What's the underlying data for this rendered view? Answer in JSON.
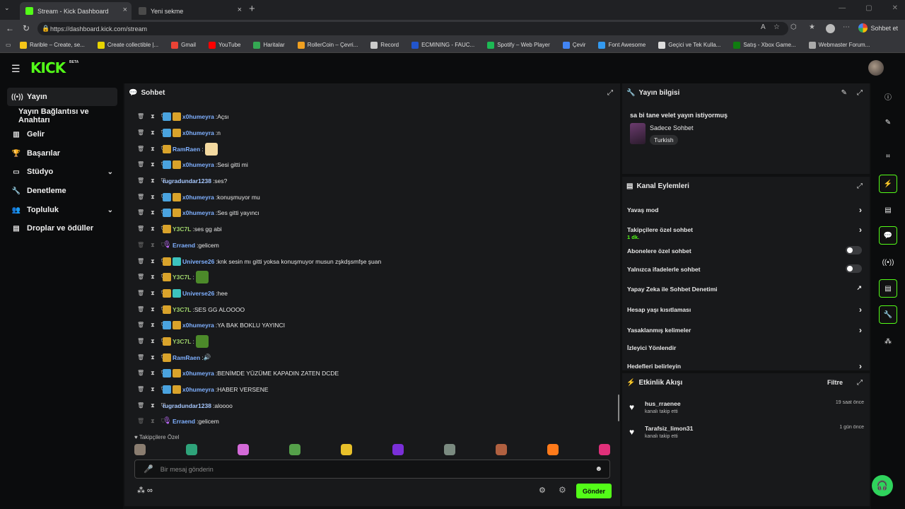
{
  "browser": {
    "tabs": [
      {
        "title": "Stream - Kick Dashboard",
        "active": true
      },
      {
        "title": "Yeni sekme",
        "active": false
      }
    ],
    "url": "https://dashboard.kick.com/stream",
    "signin_label": "Sohbet et",
    "bookmarks": [
      {
        "label": "Rarible – Create, se...",
        "color": "#f5c518"
      },
      {
        "label": "Create collectible |...",
        "color": "#e8d400"
      },
      {
        "label": "Gmail",
        "color": "#ea4335"
      },
      {
        "label": "YouTube",
        "color": "#ff0000"
      },
      {
        "label": "Haritalar",
        "color": "#34a853"
      },
      {
        "label": "RollerCoin – Çevri...",
        "color": "#f0a020"
      },
      {
        "label": "Record",
        "color": "#cccccc"
      },
      {
        "label": "ECMINING - FAUC...",
        "color": "#2255cc"
      },
      {
        "label": "Spotify – Web Player",
        "color": "#1db954"
      },
      {
        "label": "Çevir",
        "color": "#4285f4"
      },
      {
        "label": "Font Awesome",
        "color": "#339af0"
      },
      {
        "label": "Geçici ve Tek Kulla...",
        "color": "#dddddd"
      },
      {
        "label": "Satış - Xbox Game...",
        "color": "#107c10"
      },
      {
        "label": "Webmaster Forum...",
        "color": "#aaaaaa"
      }
    ]
  },
  "header": {
    "logo": "KICK",
    "beta": "BETA"
  },
  "nav": {
    "items": [
      {
        "label": "Yayın",
        "icon": "broadcast-icon",
        "glyph": "((•))",
        "active": true
      },
      {
        "label": "Yayın Bağlantısı ve Anahtarı",
        "icon": "",
        "glyph": "",
        "active": false,
        "sub": true
      },
      {
        "label": "Gelir",
        "icon": "chart-icon",
        "glyph": "▥",
        "active": false
      },
      {
        "label": "Başarılar",
        "icon": "trophy-icon",
        "glyph": "🏆",
        "active": false
      },
      {
        "label": "Stüdyo",
        "icon": "studio-icon",
        "glyph": "▭",
        "active": false,
        "chevron": true
      },
      {
        "label": "Denetleme",
        "icon": "wrench-icon",
        "glyph": "🔧",
        "active": false
      },
      {
        "label": "Topluluk",
        "icon": "people-icon",
        "glyph": "👥",
        "active": false,
        "chevron": true
      },
      {
        "label": "Droplar ve ödüller",
        "icon": "gift-icon",
        "glyph": "▤",
        "active": false
      }
    ]
  },
  "chat": {
    "title": "Sohbet",
    "messages": [
      {
        "user": "x0humeyra",
        "color": "#7fb0ff",
        "badges": [
          "blue",
          "gold"
        ],
        "text": "Açsı"
      },
      {
        "user": "x0humeyra",
        "color": "#7fb0ff",
        "badges": [
          "blue",
          "gold"
        ],
        "text": "n"
      },
      {
        "user": "RamRaen",
        "color": "#7fb0ff",
        "badges": [
          "gold"
        ],
        "text": "",
        "emote": "#f3d9a0"
      },
      {
        "user": "x0humeyra",
        "color": "#7fb0ff",
        "badges": [
          "blue",
          "gold"
        ],
        "text": "Sesi gitti mi"
      },
      {
        "user": "tugradundar1238",
        "color": "#a7c8ff",
        "badges": [],
        "text": "ses?"
      },
      {
        "user": "x0humeyra",
        "color": "#7fb0ff",
        "badges": [
          "blue",
          "gold"
        ],
        "text": "konuşmuyor mu"
      },
      {
        "user": "x0humeyra",
        "color": "#7fb0ff",
        "badges": [
          "blue",
          "gold"
        ],
        "text": "Ses gitti yayıncı"
      },
      {
        "user": "Y3C7L",
        "color": "#9ed36a",
        "badges": [
          "gold"
        ],
        "text": "ses gg abi"
      },
      {
        "user": "Erraend",
        "color": "#7fb0ff",
        "badges": [
          "mic"
        ],
        "text": "gelicem",
        "dim": true
      },
      {
        "user": "Universe26",
        "color": "#7fb0ff",
        "badges": [
          "gold",
          "teal"
        ],
        "text": "knk sesin mı gitti yoksa konuşmuyor musun zşkdşsmfşe şuan"
      },
      {
        "user": "Y3C7L",
        "color": "#9ed36a",
        "badges": [
          "gold"
        ],
        "text": "",
        "emote": "#4c8a2a"
      },
      {
        "user": "Universe26",
        "color": "#7fb0ff",
        "badges": [
          "gold",
          "teal"
        ],
        "text": "hee"
      },
      {
        "user": "Y3C7L",
        "color": "#9ed36a",
        "badges": [
          "gold"
        ],
        "text": "SES GG ALOOOO"
      },
      {
        "user": "x0humeyra",
        "color": "#7fb0ff",
        "badges": [
          "blue",
          "gold"
        ],
        "text": "YA BAK BOKLU YAYINCI"
      },
      {
        "user": "Y3C7L",
        "color": "#9ed36a",
        "badges": [
          "gold"
        ],
        "text": "",
        "emote": "#4c8a2a"
      },
      {
        "user": "RamRaen",
        "color": "#7fb0ff",
        "badges": [
          "gold"
        ],
        "text": "🔊"
      },
      {
        "user": "x0humeyra",
        "color": "#7fb0ff",
        "badges": [
          "blue",
          "gold"
        ],
        "text": "BENİMDE YÜZÜME KAPADIN ZATEN DCDE"
      },
      {
        "user": "x0humeyra",
        "color": "#7fb0ff",
        "badges": [
          "blue",
          "gold"
        ],
        "text": "HABER VERSENE"
      },
      {
        "user": "tugradundar1238",
        "color": "#a7c8ff",
        "badges": [],
        "text": "aloooo"
      },
      {
        "user": "Erraend",
        "color": "#7fb0ff",
        "badges": [
          "mic"
        ],
        "text": "gelicem",
        "dim": true
      }
    ],
    "followers_label": "Takipçilere Özel",
    "emote_colors": [
      "#8a7d70",
      "#2ea37a",
      "#d36ad8",
      "#55a04a",
      "#e8c02a",
      "#7a2fd8",
      "#7a8a80",
      "#b06040",
      "#ff7a1a",
      "#e0307a"
    ],
    "input_placeholder": "Bir mesaj gönderin",
    "send_label": "Gönder"
  },
  "stream_info": {
    "title": "Yayın bilgisi",
    "stream_title": "sa bi tane velet yayın istiyormuş",
    "category": "Sadece Sohbet",
    "language": "Turkish"
  },
  "channel_actions": {
    "title": "Kanal Eylemleri",
    "rows": [
      {
        "label": "Yavaş mod",
        "control": "chevron"
      },
      {
        "label": "Takipçilere özel sohbet",
        "sub": "1 dk.",
        "control": "chevron"
      },
      {
        "label": "Abonelere özel sohbet",
        "control": "toggle",
        "on": false
      },
      {
        "label": "Yalnızca ifadelerle sohbet",
        "control": "toggle",
        "on": false
      },
      {
        "label": "Yapay Zeka ile Sohbet Denetimi",
        "control": "external"
      },
      {
        "label": "Hesap yaşı kısıtlaması",
        "control": "chevron"
      },
      {
        "label": "Yasaklanmış kelimeler",
        "control": "chevron"
      },
      {
        "label": "İzleyici Yönlendir",
        "control": "none"
      },
      {
        "label": "Hedefleri belirleyin",
        "control": "chevron"
      }
    ]
  },
  "activity": {
    "title": "Etkinlik Akışı",
    "filter_label": "Filtre",
    "events": [
      {
        "user": "hus_rraenee",
        "action": "kanalı takip etti",
        "time": "19 saat önce"
      },
      {
        "user": "Tarafsiz_limon31",
        "action": "kanalı takip etti",
        "time": "1 gün önce"
      }
    ]
  },
  "accent": "#53fc18"
}
